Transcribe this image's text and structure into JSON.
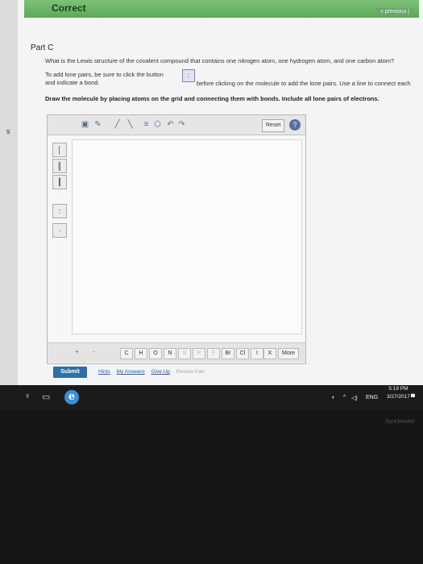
{
  "banner": {
    "status": "Correct",
    "previous_label": "« previous |"
  },
  "left_strip": {
    "letter": "s"
  },
  "part": {
    "title": "Part C"
  },
  "question": "What is the Lewis structure of the covalent compound that contains one nitrogen atom, one hydrogen atom, and one carbon atom?",
  "instructions": {
    "line1": "To add lone pairs, be sure to click the button",
    "line1b": "before clicking on the molecule to add the lone pairs. Use a line to connect each",
    "line2": "and indicate a bond.",
    "draw": "Draw the molecule by placing atoms on the grid and connecting them with bonds. Include all lone pairs of electrons."
  },
  "editor": {
    "reset_label": "Reset",
    "help_label": "?",
    "atoms": [
      "C",
      "H",
      "O",
      "N",
      "S",
      "P",
      "F",
      "Br",
      "Cl",
      "I",
      "X"
    ],
    "more_label": "More",
    "plus": "+",
    "minus": "-"
  },
  "actions": {
    "submit": "Submit",
    "hints": "Hints",
    "my_answers": "My Answers",
    "give_up": "Give Up",
    "review_part": "Review Part"
  },
  "taskbar": {
    "lang": "ENG",
    "time": "5:19 PM",
    "date": "3/27/2017"
  },
  "monitor": {
    "brand": "SyncMaster"
  },
  "colors": {
    "correct_banner": "#6ab566",
    "submit_button": "#2f6ea6",
    "link": "#2a5e9c"
  }
}
